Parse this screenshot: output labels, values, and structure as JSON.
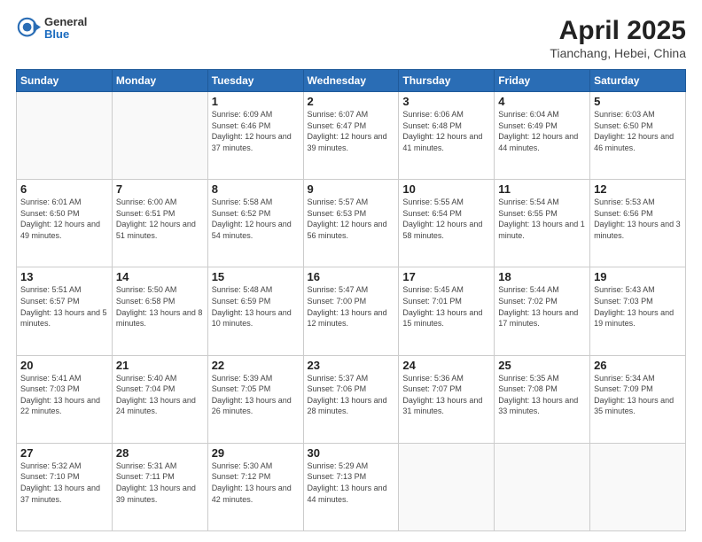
{
  "header": {
    "logo_general": "General",
    "logo_blue": "Blue",
    "title": "April 2025",
    "location": "Tianchang, Hebei, China"
  },
  "weekdays": [
    "Sunday",
    "Monday",
    "Tuesday",
    "Wednesday",
    "Thursday",
    "Friday",
    "Saturday"
  ],
  "weeks": [
    [
      {
        "day": "",
        "info": ""
      },
      {
        "day": "",
        "info": ""
      },
      {
        "day": "1",
        "info": "Sunrise: 6:09 AM\nSunset: 6:46 PM\nDaylight: 12 hours and 37 minutes."
      },
      {
        "day": "2",
        "info": "Sunrise: 6:07 AM\nSunset: 6:47 PM\nDaylight: 12 hours and 39 minutes."
      },
      {
        "day": "3",
        "info": "Sunrise: 6:06 AM\nSunset: 6:48 PM\nDaylight: 12 hours and 41 minutes."
      },
      {
        "day": "4",
        "info": "Sunrise: 6:04 AM\nSunset: 6:49 PM\nDaylight: 12 hours and 44 minutes."
      },
      {
        "day": "5",
        "info": "Sunrise: 6:03 AM\nSunset: 6:50 PM\nDaylight: 12 hours and 46 minutes."
      }
    ],
    [
      {
        "day": "6",
        "info": "Sunrise: 6:01 AM\nSunset: 6:50 PM\nDaylight: 12 hours and 49 minutes."
      },
      {
        "day": "7",
        "info": "Sunrise: 6:00 AM\nSunset: 6:51 PM\nDaylight: 12 hours and 51 minutes."
      },
      {
        "day": "8",
        "info": "Sunrise: 5:58 AM\nSunset: 6:52 PM\nDaylight: 12 hours and 54 minutes."
      },
      {
        "day": "9",
        "info": "Sunrise: 5:57 AM\nSunset: 6:53 PM\nDaylight: 12 hours and 56 minutes."
      },
      {
        "day": "10",
        "info": "Sunrise: 5:55 AM\nSunset: 6:54 PM\nDaylight: 12 hours and 58 minutes."
      },
      {
        "day": "11",
        "info": "Sunrise: 5:54 AM\nSunset: 6:55 PM\nDaylight: 13 hours and 1 minute."
      },
      {
        "day": "12",
        "info": "Sunrise: 5:53 AM\nSunset: 6:56 PM\nDaylight: 13 hours and 3 minutes."
      }
    ],
    [
      {
        "day": "13",
        "info": "Sunrise: 5:51 AM\nSunset: 6:57 PM\nDaylight: 13 hours and 5 minutes."
      },
      {
        "day": "14",
        "info": "Sunrise: 5:50 AM\nSunset: 6:58 PM\nDaylight: 13 hours and 8 minutes."
      },
      {
        "day": "15",
        "info": "Sunrise: 5:48 AM\nSunset: 6:59 PM\nDaylight: 13 hours and 10 minutes."
      },
      {
        "day": "16",
        "info": "Sunrise: 5:47 AM\nSunset: 7:00 PM\nDaylight: 13 hours and 12 minutes."
      },
      {
        "day": "17",
        "info": "Sunrise: 5:45 AM\nSunset: 7:01 PM\nDaylight: 13 hours and 15 minutes."
      },
      {
        "day": "18",
        "info": "Sunrise: 5:44 AM\nSunset: 7:02 PM\nDaylight: 13 hours and 17 minutes."
      },
      {
        "day": "19",
        "info": "Sunrise: 5:43 AM\nSunset: 7:03 PM\nDaylight: 13 hours and 19 minutes."
      }
    ],
    [
      {
        "day": "20",
        "info": "Sunrise: 5:41 AM\nSunset: 7:03 PM\nDaylight: 13 hours and 22 minutes."
      },
      {
        "day": "21",
        "info": "Sunrise: 5:40 AM\nSunset: 7:04 PM\nDaylight: 13 hours and 24 minutes."
      },
      {
        "day": "22",
        "info": "Sunrise: 5:39 AM\nSunset: 7:05 PM\nDaylight: 13 hours and 26 minutes."
      },
      {
        "day": "23",
        "info": "Sunrise: 5:37 AM\nSunset: 7:06 PM\nDaylight: 13 hours and 28 minutes."
      },
      {
        "day": "24",
        "info": "Sunrise: 5:36 AM\nSunset: 7:07 PM\nDaylight: 13 hours and 31 minutes."
      },
      {
        "day": "25",
        "info": "Sunrise: 5:35 AM\nSunset: 7:08 PM\nDaylight: 13 hours and 33 minutes."
      },
      {
        "day": "26",
        "info": "Sunrise: 5:34 AM\nSunset: 7:09 PM\nDaylight: 13 hours and 35 minutes."
      }
    ],
    [
      {
        "day": "27",
        "info": "Sunrise: 5:32 AM\nSunset: 7:10 PM\nDaylight: 13 hours and 37 minutes."
      },
      {
        "day": "28",
        "info": "Sunrise: 5:31 AM\nSunset: 7:11 PM\nDaylight: 13 hours and 39 minutes."
      },
      {
        "day": "29",
        "info": "Sunrise: 5:30 AM\nSunset: 7:12 PM\nDaylight: 13 hours and 42 minutes."
      },
      {
        "day": "30",
        "info": "Sunrise: 5:29 AM\nSunset: 7:13 PM\nDaylight: 13 hours and 44 minutes."
      },
      {
        "day": "",
        "info": ""
      },
      {
        "day": "",
        "info": ""
      },
      {
        "day": "",
        "info": ""
      }
    ]
  ]
}
